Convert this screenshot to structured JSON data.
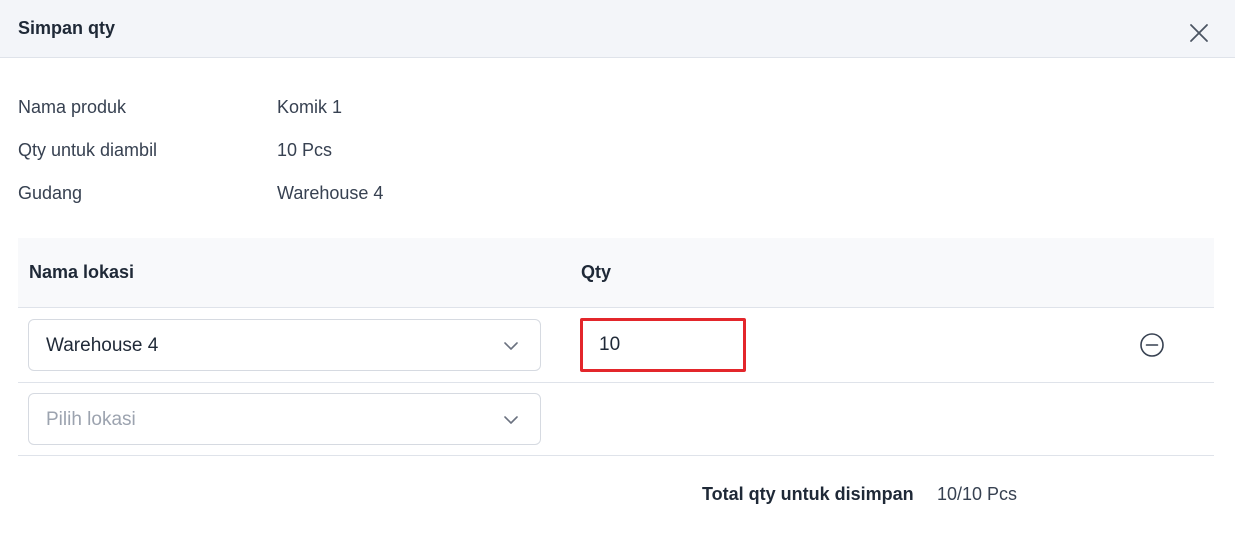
{
  "header": {
    "title": "Simpan qty",
    "close_icon": "close-icon"
  },
  "info": {
    "product_label": "Nama produk",
    "product_value": "Komik 1",
    "qty_label": "Qty untuk diambil",
    "qty_value": "10 Pcs",
    "warehouse_label": "Gudang",
    "warehouse_value": "Warehouse 4"
  },
  "table": {
    "col_location": "Nama lokasi",
    "col_qty": "Qty",
    "rows": [
      {
        "location": "Warehouse 4",
        "qty": "10"
      }
    ],
    "new_row_placeholder": "Pilih lokasi"
  },
  "total": {
    "label": "Total qty untuk disimpan",
    "value": "10/10 Pcs"
  },
  "colors": {
    "header_bg": "#f3f5f9",
    "highlight_border": "#e3262b",
    "placeholder": "#9ca3af"
  }
}
